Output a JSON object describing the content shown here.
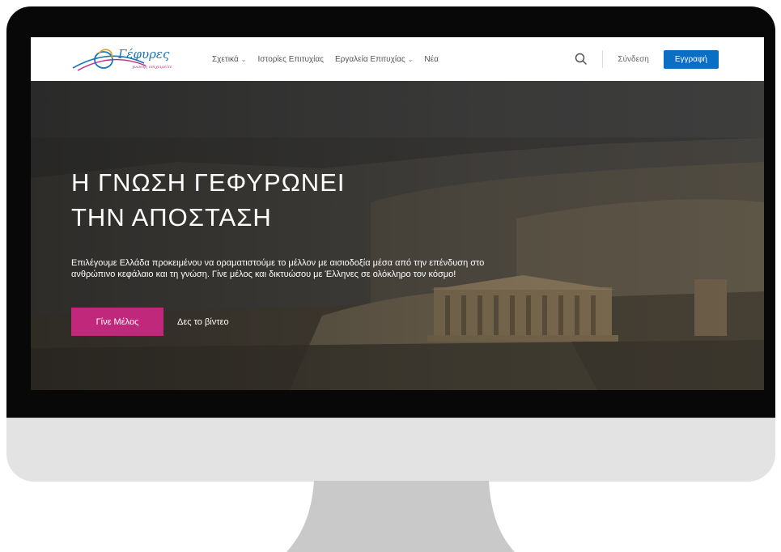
{
  "brand": {
    "logo_text": "Γέφυρες",
    "logo_tagline": "γνώσης επιχειρείτε",
    "accent": "#c0297b",
    "primary": "#0a6ec5"
  },
  "nav": {
    "items": [
      {
        "label": "Σχετικά",
        "has_dropdown": true
      },
      {
        "label": "Ιστορίες Επιτυχίας",
        "has_dropdown": false
      },
      {
        "label": "Εργαλεία Επιτυχίας",
        "has_dropdown": true
      },
      {
        "label": "Νέα",
        "has_dropdown": false
      }
    ],
    "search_icon": "search-icon",
    "login_label": "Σύνδεση",
    "register_label": "Εγγραφή"
  },
  "hero": {
    "title_line1": "Η ΓΝΩΣΗ ΓΕΦΥΡΩΝΕΙ",
    "title_line2": "ΤΗΝ ΑΠΟΣΤΑΣΗ",
    "description": "Επιλέγουμε Ελλάδα προκειμένου να οραματιστούμε το μέλλον με αισιοδοξία μέσα από την επένδυση στο ανθρώπινο κεφάλαιο και τη γνώση. Γίνε μέλος και δικτυώσου με Έλληνες σε ολόκληρο τον κόσμο!",
    "cta_label": "Γίνε Μέλος",
    "video_label": "Δες το βίντεο"
  }
}
